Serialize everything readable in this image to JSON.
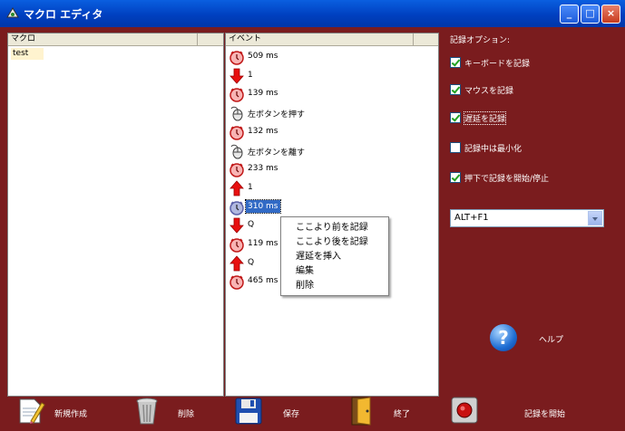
{
  "window": {
    "title": "マクロ エディタ"
  },
  "macro_panel": {
    "header": "マクロ",
    "items": [
      "test"
    ]
  },
  "event_panel": {
    "header": "イベント",
    "events": [
      {
        "icon": "timer-icon",
        "text": "509 ms"
      },
      {
        "icon": "arrow-down-icon",
        "text": "1"
      },
      {
        "icon": "timer-icon",
        "text": "139 ms"
      },
      {
        "icon": "mouse-icon",
        "text": "左ボタンを押す"
      },
      {
        "icon": "timer-icon",
        "text": "132 ms"
      },
      {
        "icon": "mouse-icon",
        "text": "左ボタンを離す"
      },
      {
        "icon": "timer-icon",
        "text": "233 ms"
      },
      {
        "icon": "arrow-up-icon",
        "text": "1"
      },
      {
        "icon": "timer-icon",
        "text": "310 ms",
        "selected": true
      },
      {
        "icon": "arrow-down-icon",
        "text": "Q"
      },
      {
        "icon": "timer-icon",
        "text": "119 ms"
      },
      {
        "icon": "arrow-up-icon",
        "text": "Q"
      },
      {
        "icon": "timer-icon",
        "text": "465 ms"
      }
    ]
  },
  "context_menu": {
    "items": [
      "ここより前を記録",
      "ここより後を記録",
      "遅延を挿入",
      "編集",
      "削除"
    ]
  },
  "options": {
    "title": "記録オプション:",
    "items": [
      {
        "label": "キーボードを記録",
        "checked": true
      },
      {
        "label": "マウスを記録",
        "checked": true
      },
      {
        "label": "遅延を記録",
        "checked": true
      },
      {
        "label": "記録中は最小化",
        "checked": false
      },
      {
        "label": "押下で記録を開始/停止",
        "checked": true
      }
    ],
    "hotkey": "ALT+F1"
  },
  "help": {
    "label": "ヘルプ"
  },
  "bottom_bar": {
    "new_label": "新規作成",
    "delete_label": "削除",
    "save_label": "保存",
    "exit_label": "終了",
    "record_label": "記録を開始"
  },
  "colors": {
    "background": "#7a1c1e",
    "titlebar": "#0a5fe0",
    "selection": "#316ac5"
  }
}
